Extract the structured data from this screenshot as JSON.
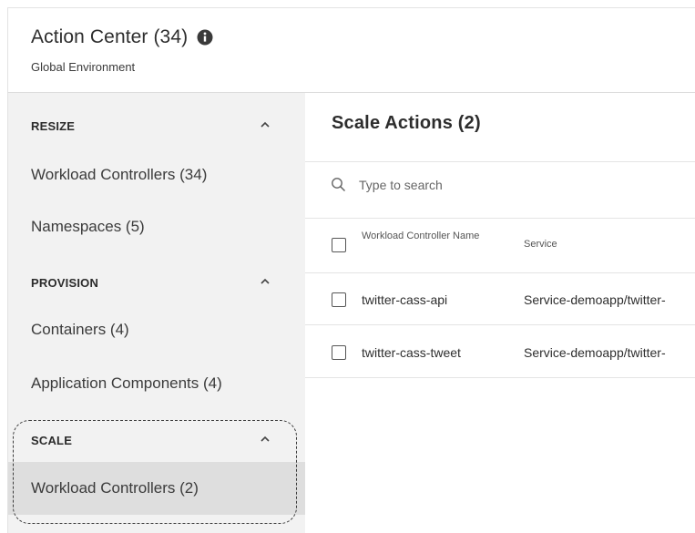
{
  "header": {
    "title": "Action Center (34)",
    "subtitle": "Global Environment"
  },
  "sidebar": {
    "sections": [
      {
        "label": "RESIZE",
        "items": [
          {
            "label": "Workload Controllers (34)"
          },
          {
            "label": "Namespaces (5)"
          }
        ]
      },
      {
        "label": "PROVISION",
        "items": [
          {
            "label": "Containers (4)"
          },
          {
            "label": "Application Components (4)"
          }
        ]
      },
      {
        "label": "SCALE",
        "items": [
          {
            "label": "Workload Controllers (2)",
            "selected": true
          }
        ]
      }
    ]
  },
  "main": {
    "title": "Scale Actions (2)",
    "search": {
      "placeholder": "Type to search",
      "value": ""
    },
    "table": {
      "columns": [
        "Workload Controller Name",
        "Service"
      ],
      "rows": [
        {
          "name": "twitter-cass-api",
          "service": "Service-demoapp/twitter-"
        },
        {
          "name": "twitter-cass-tweet",
          "service": "Service-demoapp/twitter-"
        }
      ]
    }
  },
  "icons": {
    "info": "info-circle-icon",
    "collapse": "chevron-up-icon",
    "search": "search-icon"
  }
}
